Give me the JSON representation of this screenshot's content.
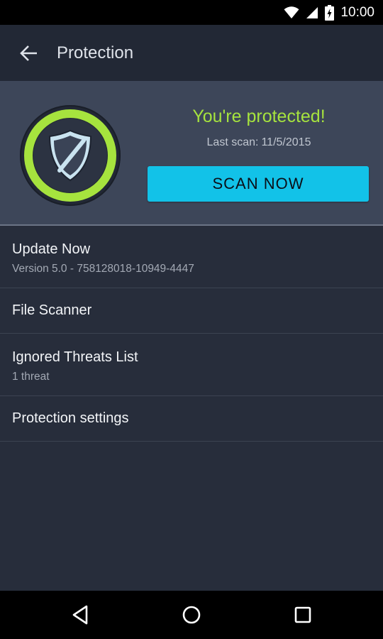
{
  "status_bar": {
    "time": "10:00",
    "icons": [
      "wifi-icon",
      "signal-icon",
      "battery-charging-icon"
    ]
  },
  "app_bar": {
    "title": "Protection",
    "back_icon": "arrow-back-icon"
  },
  "hero": {
    "status_title": "You're protected!",
    "last_scan_label": "Last scan:",
    "last_scan_date": "11/5/2015",
    "scan_button_label": "SCAN NOW",
    "shield_icon": "shield-protected-icon"
  },
  "items": [
    {
      "label": "Update Now",
      "sub": "Version 5.0 - 758128018-10949-4447"
    },
    {
      "label": "File Scanner"
    },
    {
      "label": "Ignored Threats List",
      "sub": "1 threat"
    },
    {
      "label": "Protection settings"
    }
  ],
  "nav_bar": {
    "icons": [
      "back-triangle-icon",
      "home-circle-icon",
      "recents-square-icon"
    ]
  },
  "colors": {
    "background": "#272d3b",
    "app_bar": "#222835",
    "hero": "#3d4659",
    "accent_green": "#a6e33e",
    "accent_cyan": "#12c2e8"
  }
}
